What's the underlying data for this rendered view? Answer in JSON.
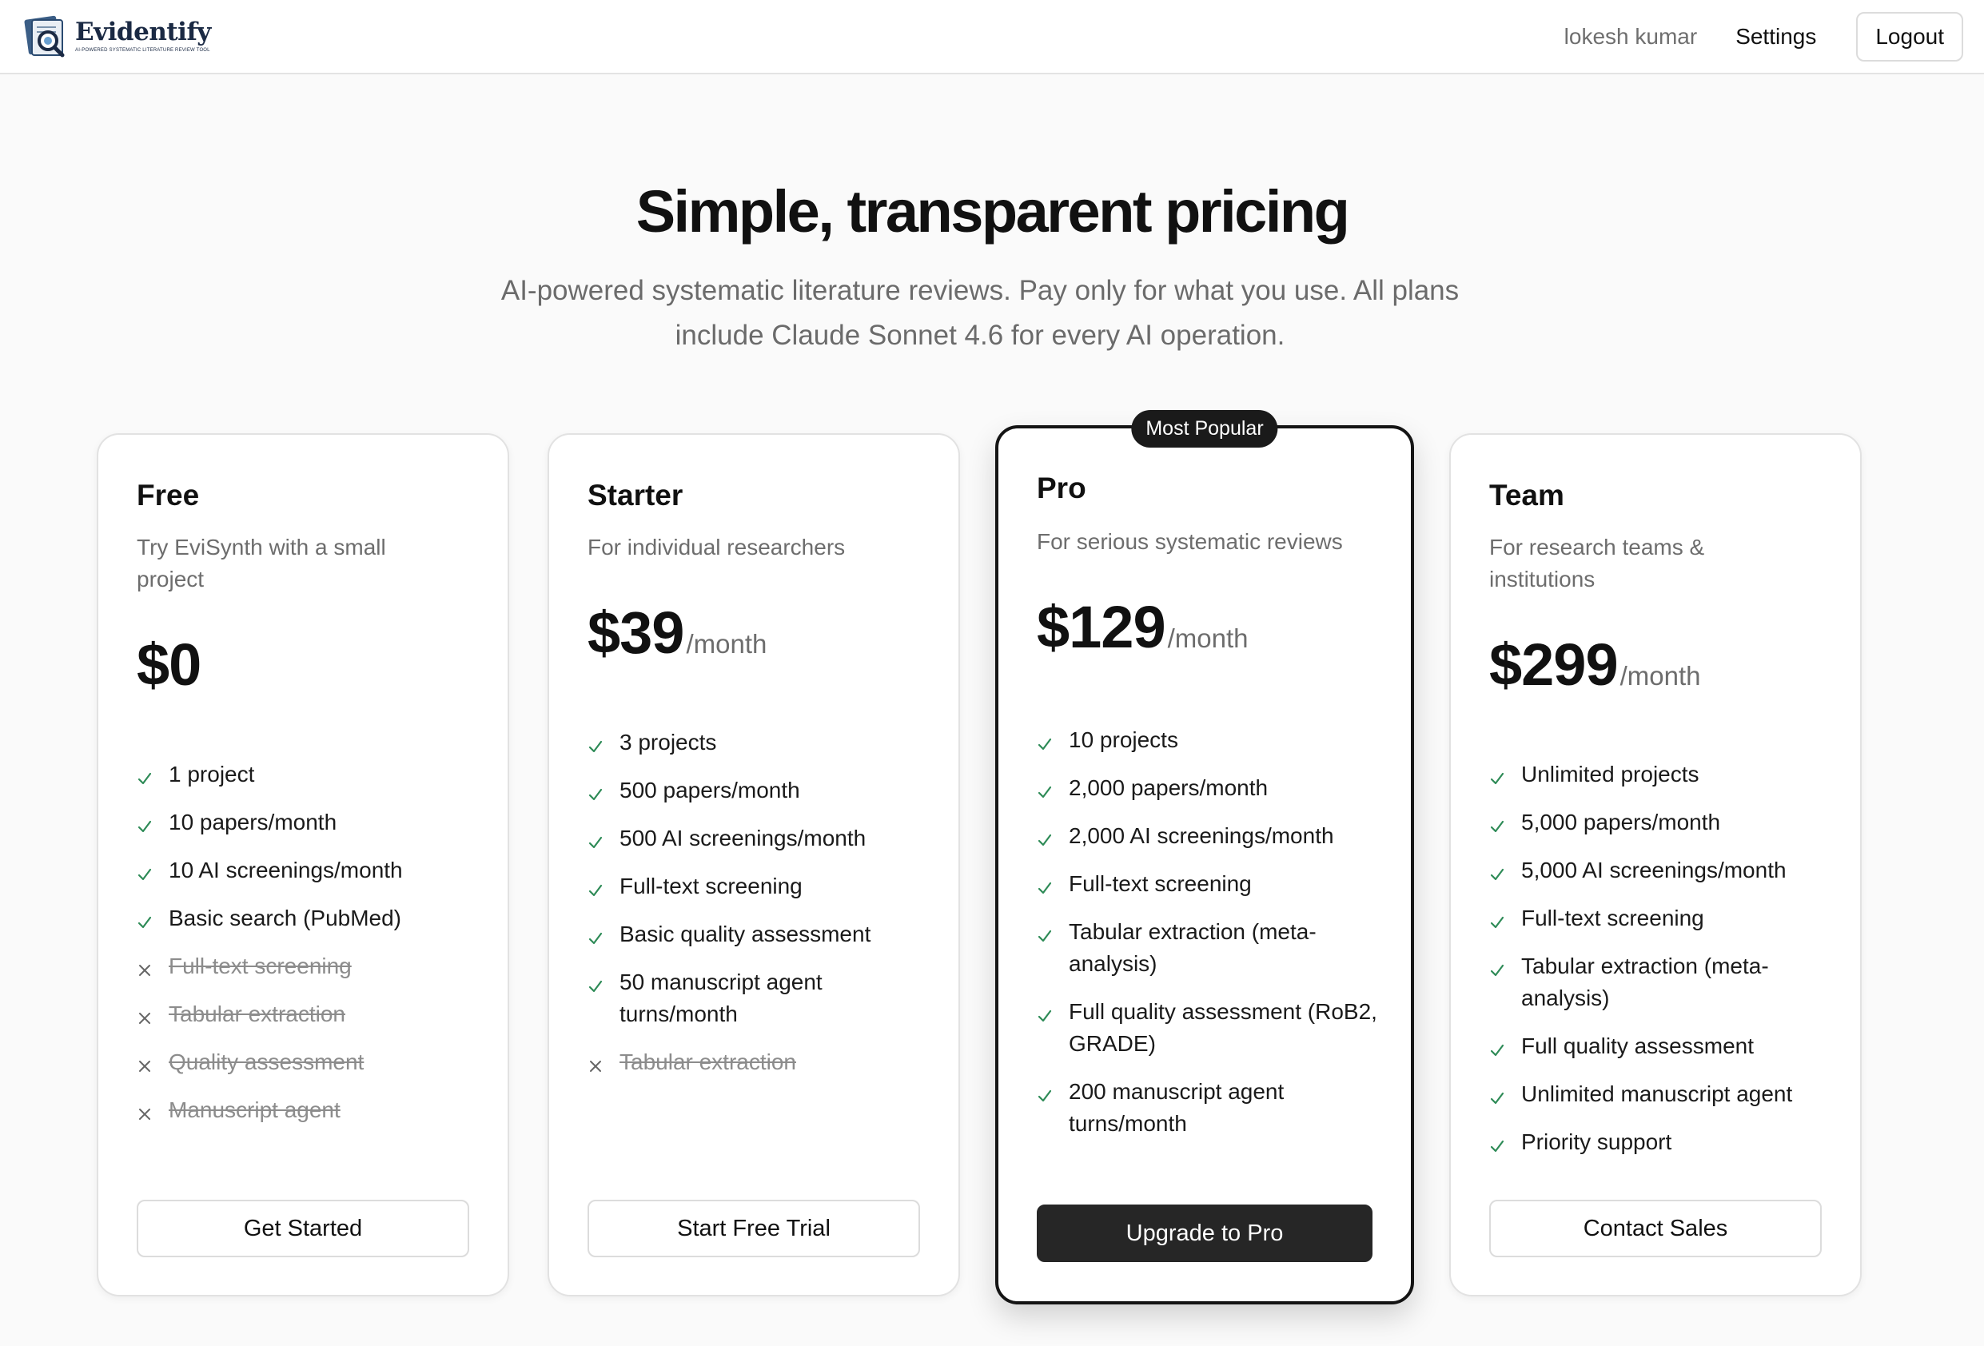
{
  "header": {
    "brand_name": "Evidentify",
    "brand_tagline": "AI-POWERED SYSTEMATIC LITERATURE REVIEW TOOL",
    "user_name": "lokesh kumar",
    "settings_label": "Settings",
    "logout_label": "Logout"
  },
  "hero": {
    "title": "Simple, transparent pricing",
    "subtitle": "AI-powered systematic literature reviews. Pay only for what you use. All plans include Claude Sonnet 4.6 for every AI operation."
  },
  "plans": [
    {
      "name": "Free",
      "description": "Try EviSynth with a small project",
      "price": "$0",
      "period": "",
      "cta": "Get Started",
      "features": [
        {
          "text": "1 project",
          "included": true
        },
        {
          "text": "10 papers/month",
          "included": true
        },
        {
          "text": "10 AI screenings/month",
          "included": true
        },
        {
          "text": "Basic search (PubMed)",
          "included": true
        },
        {
          "text": "Full-text screening",
          "included": false
        },
        {
          "text": "Tabular extraction",
          "included": false
        },
        {
          "text": "Quality assessment",
          "included": false
        },
        {
          "text": "Manuscript agent",
          "included": false
        }
      ]
    },
    {
      "name": "Starter",
      "description": "For individual researchers",
      "price": "$39",
      "period": "/month",
      "cta": "Start Free Trial",
      "features": [
        {
          "text": "3 projects",
          "included": true
        },
        {
          "text": "500 papers/month",
          "included": true
        },
        {
          "text": "500 AI screenings/month",
          "included": true
        },
        {
          "text": "Full-text screening",
          "included": true
        },
        {
          "text": "Basic quality assessment",
          "included": true
        },
        {
          "text": "50 manuscript agent turns/month",
          "included": true
        },
        {
          "text": "Tabular extraction",
          "included": false
        }
      ]
    },
    {
      "name": "Pro",
      "badge": "Most Popular",
      "description": "For serious systematic reviews",
      "price": "$129",
      "period": "/month",
      "cta": "Upgrade to Pro",
      "features": [
        {
          "text": "10 projects",
          "included": true
        },
        {
          "text": "2,000 papers/month",
          "included": true
        },
        {
          "text": "2,000 AI screenings/month",
          "included": true
        },
        {
          "text": "Full-text screening",
          "included": true
        },
        {
          "text": "Tabular extraction (meta-analysis)",
          "included": true
        },
        {
          "text": "Full quality assessment (RoB2, GRADE)",
          "included": true
        },
        {
          "text": "200 manuscript agent turns/month",
          "included": true
        }
      ]
    },
    {
      "name": "Team",
      "description": "For research teams & institutions",
      "price": "$299",
      "period": "/month",
      "cta": "Contact Sales",
      "features": [
        {
          "text": "Unlimited projects",
          "included": true
        },
        {
          "text": "5,000 papers/month",
          "included": true
        },
        {
          "text": "5,000 AI screenings/month",
          "included": true
        },
        {
          "text": "Full-text screening",
          "included": true
        },
        {
          "text": "Tabular extraction (meta-analysis)",
          "included": true
        },
        {
          "text": "Full quality assessment",
          "included": true
        },
        {
          "text": "Unlimited manuscript agent",
          "included": true
        },
        {
          "text": "Priority support",
          "included": true
        }
      ]
    }
  ],
  "colors": {
    "check": "#2e8b57",
    "cross": "#666666",
    "primary_button": "#262626"
  },
  "icons": {
    "included": "checkmark-icon",
    "excluded": "cross-icon"
  }
}
